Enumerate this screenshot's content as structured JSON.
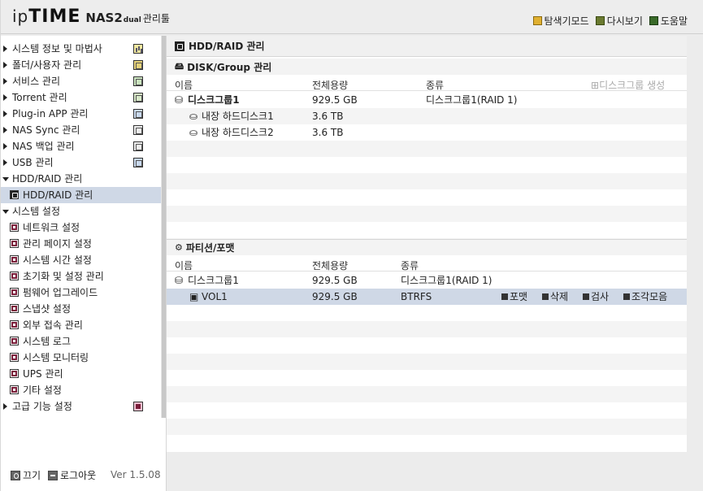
{
  "header": {
    "logo_ip": "ip",
    "logo_time": "TIME",
    "logo_nas": "NAS2",
    "logo_dual": "dual",
    "logo_mgr": "관리툴",
    "links": [
      {
        "icon": "explore-icon",
        "label": "탐색기모드"
      },
      {
        "icon": "refresh-icon",
        "label": "다시보기"
      },
      {
        "icon": "help-icon",
        "label": "도움말"
      }
    ]
  },
  "sidebar": {
    "items": [
      {
        "label": "시스템 정보 및 마법사",
        "icon": "system-info-icon"
      },
      {
        "label": "폴더/사용자 관리",
        "icon": "folder-user-icon"
      },
      {
        "label": "서비스 관리",
        "icon": "service-icon"
      },
      {
        "label": "Torrent 관리",
        "icon": "torrent-icon"
      },
      {
        "label": "Plug-in APP 관리",
        "icon": "plugin-icon"
      },
      {
        "label": "NAS Sync 관리",
        "icon": "nas-sync-icon"
      },
      {
        "label": "NAS 백업 관리",
        "icon": "nas-backup-icon"
      },
      {
        "label": "USB 관리",
        "icon": "usb-icon"
      },
      {
        "label": "HDD/RAID 관리"
      },
      {
        "label": "HDD/RAID 관리"
      },
      {
        "label": "시스템 설정"
      },
      {
        "label": "네트워크 설정"
      },
      {
        "label": "관리 페이지 설정"
      },
      {
        "label": "시스템 시간 설정"
      },
      {
        "label": "초기화 및 설정 관리"
      },
      {
        "label": "펌웨어 업그레이드"
      },
      {
        "label": "스냅샷 설정"
      },
      {
        "label": "외부 접속 관리"
      },
      {
        "label": "시스템 로그"
      },
      {
        "label": "시스템 모니터링"
      },
      {
        "label": "UPS 관리"
      },
      {
        "label": "기타 설정"
      },
      {
        "label": "고급 기능 설정",
        "icon": "advanced-icon"
      }
    ],
    "footer": {
      "power_label": "끄기",
      "logout_label": "로그아웃",
      "version": "Ver 1.5.08"
    }
  },
  "main": {
    "title": "HDD/RAID 관리",
    "disk_section": {
      "title": "DISK/Group 관리",
      "columns": [
        "이름",
        "전체용량",
        "종류"
      ],
      "create_label": "디스크그룹 생성",
      "rows": [
        {
          "name": "디스크그룹1",
          "capacity": "929.5 GB",
          "type": "디스크그룹1(RAID 1)"
        },
        {
          "name": "내장 하드디스크1",
          "capacity": "3.6 TB",
          "type": ""
        },
        {
          "name": "내장 하드디스크2",
          "capacity": "3.6 TB",
          "type": ""
        }
      ]
    },
    "partition_section": {
      "title": "파티션/포맷",
      "columns": [
        "이름",
        "전체용량",
        "종류"
      ],
      "rows": [
        {
          "name": "디스크그룹1",
          "capacity": "929.5 GB",
          "type": "디스크그룹1(RAID 1)"
        },
        {
          "name": "VOL1",
          "capacity": "929.5 GB",
          "type": "BTRFS"
        }
      ],
      "actions": [
        "포맷",
        "삭제",
        "검사",
        "조각모음"
      ]
    }
  }
}
